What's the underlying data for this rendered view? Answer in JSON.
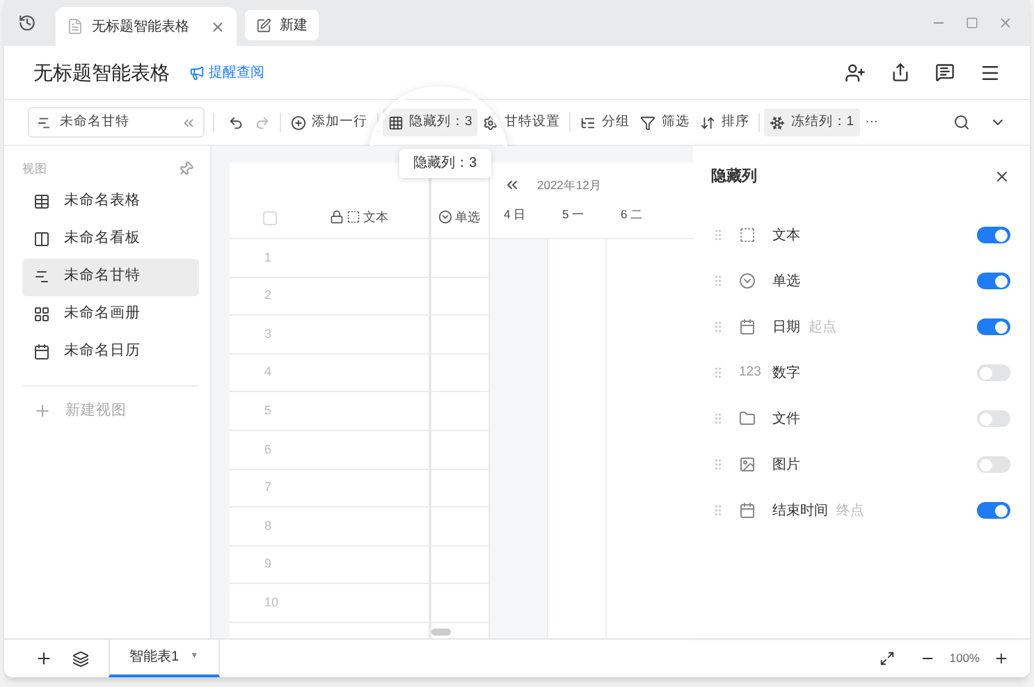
{
  "tabs": [
    {
      "title": "无标题智能表格",
      "selected": true,
      "closable": true
    },
    {
      "title": "新建",
      "selected": false,
      "closable": false
    }
  ],
  "header": {
    "title": "无标题智能表格",
    "remind_link": "提醒查阅"
  },
  "toolbar": {
    "view_selector": "未命名甘特",
    "items": [
      {
        "kind": "undo",
        "selected": false
      },
      {
        "kind": "redo",
        "selected": false
      },
      {
        "kind": "add_row",
        "label": "添加一行",
        "selected": false
      },
      {
        "kind": "hidden",
        "label": "隐藏列：3",
        "selected": true
      },
      {
        "kind": "gantt_settings",
        "label": "甘特设置",
        "selected": false
      },
      {
        "kind": "group",
        "label": "分组",
        "selected": false
      },
      {
        "kind": "filter",
        "label": "筛选",
        "selected": false
      },
      {
        "kind": "sort",
        "label": "排序",
        "selected": false
      },
      {
        "kind": "frozen",
        "label": "冻结列：1",
        "selected": true
      },
      {
        "kind": "more",
        "label": "···",
        "selected": false
      }
    ]
  },
  "magnifier_tooltip": "隐藏列：3",
  "sidebar": {
    "heading": "视图",
    "items": [
      {
        "label": "未命名表格",
        "kind": "table",
        "selected": false
      },
      {
        "label": "未命名看板",
        "kind": "kanban",
        "selected": false
      },
      {
        "label": "未命名甘特",
        "kind": "gantt",
        "selected": true
      },
      {
        "label": "未命名画册",
        "kind": "gallery",
        "selected": false
      },
      {
        "label": "未命名日历",
        "kind": "calendar",
        "selected": false
      }
    ],
    "new_view": "新建视图"
  },
  "table": {
    "select_all_checked": false,
    "columns": [
      {
        "label": "文本",
        "kind": "text",
        "locked": true
      },
      {
        "label": "单选",
        "kind": "select",
        "locked": false
      }
    ],
    "rows": [
      "1",
      "2",
      "3",
      "4",
      "5",
      "6",
      "7",
      "8",
      "9",
      "10"
    ]
  },
  "gantt": {
    "month": "2022年12月",
    "days": [
      "4 日",
      "5 一",
      "6 二"
    ]
  },
  "panel": {
    "title": "隐藏列",
    "fields": [
      {
        "name": "文本",
        "kind": "text",
        "on": true
      },
      {
        "name": "单选",
        "kind": "select",
        "on": true
      },
      {
        "name": "日期",
        "note": "起点",
        "kind": "date",
        "on": true
      },
      {
        "name": "数字",
        "kind": "number",
        "icon_text": "123",
        "on": false
      },
      {
        "name": "文件",
        "kind": "file",
        "on": false
      },
      {
        "name": "图片",
        "kind": "image",
        "on": false
      },
      {
        "name": "结束时间",
        "note": "终点",
        "kind": "date",
        "on": true
      }
    ]
  },
  "bottom": {
    "sheets": [
      {
        "label": "智能表1",
        "caret": "▼",
        "selected": true
      }
    ],
    "zoom": "100%"
  }
}
